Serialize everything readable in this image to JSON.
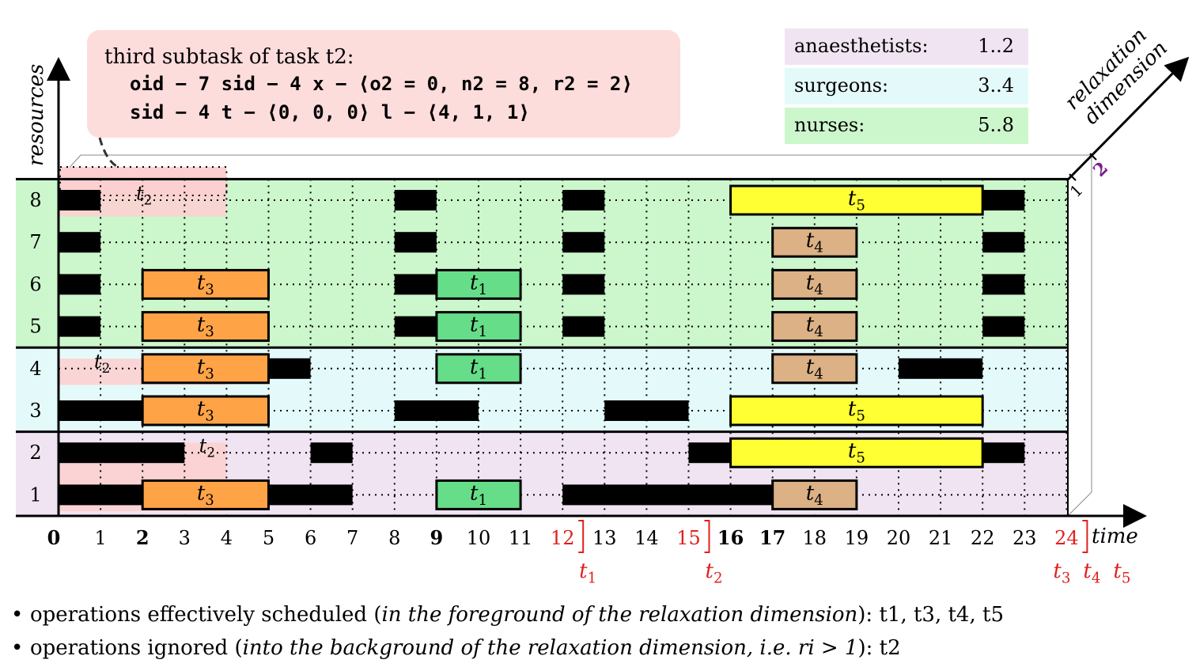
{
  "axes": {
    "y_label": "resources",
    "x_label": "time",
    "z_label_line1": "relaxation",
    "z_label_line2": "dimension",
    "z_ticks": [
      "1",
      "2"
    ]
  },
  "resources": [
    "1",
    "2",
    "3",
    "4",
    "5",
    "6",
    "7",
    "8"
  ],
  "time_ticks": [
    "0",
    "1",
    "2",
    "3",
    "4",
    "5",
    "6",
    "7",
    "8",
    "9",
    "10",
    "11",
    "12",
    "13",
    "14",
    "15",
    "16",
    "17",
    "18",
    "19",
    "20",
    "21",
    "22",
    "23",
    "24"
  ],
  "bold_ticks": [
    "0",
    "2",
    "9",
    "16",
    "17"
  ],
  "red_ticks": [
    "12",
    "15",
    "24"
  ],
  "deadlines": [
    {
      "time": 12,
      "labels": [
        "t1"
      ]
    },
    {
      "time": 15,
      "labels": [
        "t2"
      ]
    },
    {
      "time": 24,
      "labels": [
        "t3",
        "t4",
        "t5"
      ]
    }
  ],
  "groups": [
    {
      "name": "anaesthetists",
      "range": "1..2",
      "from": 1,
      "to": 2,
      "color": "#f0e4f2"
    },
    {
      "name": "surgeons",
      "range": "3..4",
      "from": 3,
      "to": 4,
      "color": "#e4fafa"
    },
    {
      "name": "nurses",
      "range": "5..8",
      "from": 5,
      "to": 8,
      "color": "#ccf7cc"
    }
  ],
  "legend": [
    {
      "label": "anaesthetists:",
      "value": "1..2",
      "color": "#f0e4f2"
    },
    {
      "label": "surgeons:",
      "value": "3..4",
      "color": "#e4fafa"
    },
    {
      "label": "nurses:",
      "value": "5..8",
      "color": "#ccf7cc"
    }
  ],
  "callout": {
    "title": "third subtask of task t2:",
    "line1": "oid − 7 sid − 4 x − ⟨o2 = 0, n2 = 8, r2 = 2⟩",
    "line2": "sid − 4 t − ⟨0, 0, 0⟩ l − ⟨4, 1, 1⟩",
    "color": "#fddcdc"
  },
  "task_colors": {
    "t1": "#66dd88",
    "t3": "#ffa347",
    "t4": "#dbb185",
    "t5": "#ffff33",
    "busy": "#000000"
  },
  "tasks": [
    {
      "label": "t1",
      "resource": 1,
      "start": 9,
      "end": 11
    },
    {
      "label": "t1",
      "resource": 4,
      "start": 9,
      "end": 11
    },
    {
      "label": "t1",
      "resource": 5,
      "start": 9,
      "end": 11
    },
    {
      "label": "t1",
      "resource": 6,
      "start": 9,
      "end": 11
    },
    {
      "label": "t3",
      "resource": 1,
      "start": 2,
      "end": 5
    },
    {
      "label": "t3",
      "resource": 3,
      "start": 2,
      "end": 5
    },
    {
      "label": "t3",
      "resource": 4,
      "start": 2,
      "end": 5
    },
    {
      "label": "t3",
      "resource": 5,
      "start": 2,
      "end": 5
    },
    {
      "label": "t3",
      "resource": 6,
      "start": 2,
      "end": 5
    },
    {
      "label": "t4",
      "resource": 1,
      "start": 17,
      "end": 19
    },
    {
      "label": "t4",
      "resource": 4,
      "start": 17,
      "end": 19
    },
    {
      "label": "t4",
      "resource": 5,
      "start": 17,
      "end": 19
    },
    {
      "label": "t4",
      "resource": 6,
      "start": 17,
      "end": 19
    },
    {
      "label": "t4",
      "resource": 7,
      "start": 17,
      "end": 19
    },
    {
      "label": "t5",
      "resource": 2,
      "start": 16,
      "end": 22
    },
    {
      "label": "t5",
      "resource": 3,
      "start": 16,
      "end": 22
    },
    {
      "label": "t5",
      "resource": 8,
      "start": 16,
      "end": 22
    }
  ],
  "unavailable": [
    {
      "resource": 1,
      "start": 0,
      "end": 2
    },
    {
      "resource": 1,
      "start": 5,
      "end": 7
    },
    {
      "resource": 1,
      "start": 12,
      "end": 17
    },
    {
      "resource": 2,
      "start": 0,
      "end": 3
    },
    {
      "resource": 2,
      "start": 6,
      "end": 7
    },
    {
      "resource": 2,
      "start": 15,
      "end": 16
    },
    {
      "resource": 2,
      "start": 22,
      "end": 23
    },
    {
      "resource": 3,
      "start": 0,
      "end": 2
    },
    {
      "resource": 3,
      "start": 8,
      "end": 10
    },
    {
      "resource": 3,
      "start": 13,
      "end": 15
    },
    {
      "resource": 4,
      "start": 5,
      "end": 6
    },
    {
      "resource": 4,
      "start": 20,
      "end": 22
    },
    {
      "resource": 5,
      "start": 0,
      "end": 1
    },
    {
      "resource": 5,
      "start": 8,
      "end": 9
    },
    {
      "resource": 5,
      "start": 12,
      "end": 13
    },
    {
      "resource": 5,
      "start": 22,
      "end": 23
    },
    {
      "resource": 6,
      "start": 0,
      "end": 1
    },
    {
      "resource": 6,
      "start": 8,
      "end": 9
    },
    {
      "resource": 6,
      "start": 12,
      "end": 13
    },
    {
      "resource": 6,
      "start": 22,
      "end": 23
    },
    {
      "resource": 7,
      "start": 0,
      "end": 1
    },
    {
      "resource": 7,
      "start": 8,
      "end": 9
    },
    {
      "resource": 7,
      "start": 12,
      "end": 13
    },
    {
      "resource": 7,
      "start": 22,
      "end": 23
    },
    {
      "resource": 8,
      "start": 0,
      "end": 1
    },
    {
      "resource": 8,
      "start": 8,
      "end": 9
    },
    {
      "resource": 8,
      "start": 12,
      "end": 13
    },
    {
      "resource": 8,
      "start": 22,
      "end": 23
    }
  ],
  "ignored_task": {
    "label": "t2",
    "relaxation": 2,
    "start": 0,
    "end": 4,
    "labels": [
      {
        "resource": 2,
        "time": 3.5
      },
      {
        "resource": 4,
        "time": 1
      },
      {
        "resource": 8,
        "time": 2
      }
    ]
  },
  "bullets": {
    "line1_prefix": "operations effectively scheduled (",
    "line1_italic": "in the foreground of the relaxation dimension",
    "line1_suffix": "): t1, t3, t4, t5",
    "line2_prefix": "operations ignored (",
    "line2_italic": "into the background of the relaxation dimension, i.e. ri > 1",
    "line2_suffix": "): t2"
  }
}
